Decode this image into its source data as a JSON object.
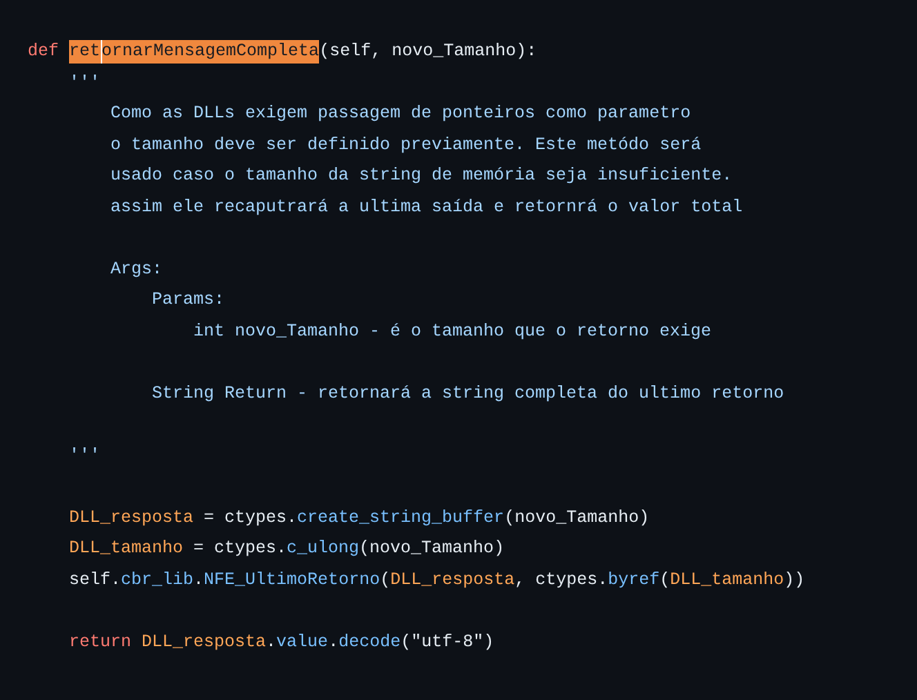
{
  "editor": {
    "lines": [
      {
        "kind": "code",
        "tokens": [
          {
            "text": "def",
            "kind": "keyword"
          },
          {
            "text": "ret",
            "kind": "function",
            "highlighted": true
          },
          {
            "kind": "cursor"
          },
          {
            "text": "ornarMensagemCompleta",
            "kind": "function",
            "highlighted": true
          },
          {
            "text": "(self, novo_Tamanho):",
            "kind": "plain"
          }
        ],
        "children": [
          {
            "kind": "code",
            "tokens": [
              {
                "text": "'''",
                "kind": "docstring"
              }
            ],
            "children": [
              {
                "kind": "code",
                "tokens": [
                  {
                    "text": "Como as DLLs exigem passagem de ponteiros como parametro",
                    "kind": "docstring"
                  }
                ]
              },
              {
                "kind": "code",
                "tokens": [
                  {
                    "text": "o tamanho deve ser definido previamente. Este metódo será",
                    "kind": "docstring"
                  }
                ]
              },
              {
                "kind": "code",
                "tokens": [
                  {
                    "text": "usado caso o tamanho da string de memória seja insuficiente.",
                    "kind": "docstring"
                  }
                ]
              },
              {
                "kind": "code",
                "tokens": [
                  {
                    "text": "assim ele recaputrará a ultima saída e retornrá o valor total",
                    "kind": "docstring"
                  }
                ]
              },
              {
                "kind": "blank"
              },
              {
                "kind": "code",
                "tokens": [
                  {
                    "text": "Args:",
                    "kind": "docstring"
                  }
                ],
                "children": [
                  {
                    "kind": "code",
                    "tokens": [
                      {
                        "text": "Params:",
                        "kind": "docstring"
                      }
                    ],
                    "children": [
                      {
                        "kind": "code",
                        "tokens": [
                          {
                            "text": "int novo_Tamanho - é o tamanho que o retorno exige",
                            "kind": "docstring"
                          }
                        ]
                      }
                    ]
                  },
                  {
                    "kind": "blank"
                  },
                  {
                    "kind": "code",
                    "tokens": [
                      {
                        "text": "String Return - retornará a string completa do ultimo retorno",
                        "kind": "docstring"
                      }
                    ]
                  }
                ]
              },
              {
                "kind": "blank"
              }
            ]
          },
          {
            "kind": "code",
            "tokens": [
              {
                "text": "'''",
                "kind": "docstring"
              }
            ]
          },
          {
            "kind": "blank"
          },
          {
            "kind": "code",
            "tokens": [
              {
                "text": "DLL_resposta",
                "kind": "variable"
              },
              {
                "text": " = ctypes.",
                "kind": "plain"
              },
              {
                "text": "create_string_buffer",
                "kind": "attribute"
              },
              {
                "text": "(novo_Tamanho)",
                "kind": "plain"
              }
            ]
          },
          {
            "kind": "code",
            "tokens": [
              {
                "text": "DLL_tamanho",
                "kind": "variable"
              },
              {
                "text": " = ctypes.",
                "kind": "plain"
              },
              {
                "text": "c_ulong",
                "kind": "attribute"
              },
              {
                "text": "(novo_Tamanho)",
                "kind": "plain"
              }
            ]
          },
          {
            "kind": "code",
            "tokens": [
              {
                "text": "self.",
                "kind": "plain"
              },
              {
                "text": "cbr_lib",
                "kind": "attribute"
              },
              {
                "text": ".",
                "kind": "plain"
              },
              {
                "text": "NFE_UltimoRetorno",
                "kind": "attribute"
              },
              {
                "text": "(",
                "kind": "plain"
              },
              {
                "text": "DLL_resposta",
                "kind": "variable"
              },
              {
                "text": ", ctypes.",
                "kind": "plain"
              },
              {
                "text": "byref",
                "kind": "attribute"
              },
              {
                "text": "(",
                "kind": "plain"
              },
              {
                "text": "DLL_tamanho",
                "kind": "variable"
              },
              {
                "text": "))",
                "kind": "plain"
              }
            ]
          },
          {
            "kind": "blank"
          },
          {
            "kind": "code",
            "tokens": [
              {
                "text": "return",
                "kind": "keyword"
              },
              {
                "text": "DLL_resposta",
                "kind": "variable"
              },
              {
                "text": ".",
                "kind": "plain"
              },
              {
                "text": "value",
                "kind": "attribute"
              },
              {
                "text": ".",
                "kind": "plain"
              },
              {
                "text": "decode",
                "kind": "attribute"
              },
              {
                "text": "(\"utf-8\")",
                "kind": "plain"
              }
            ]
          }
        ]
      }
    ]
  }
}
